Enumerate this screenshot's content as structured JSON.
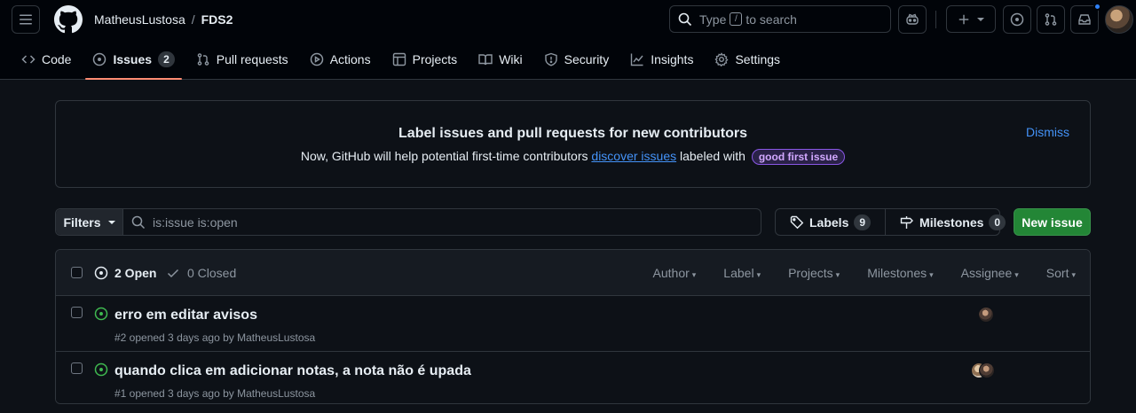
{
  "header": {
    "owner": "MatheusLustosa",
    "separator": "/",
    "repo": "FDS2",
    "search": {
      "prefix": "Type",
      "key": "/",
      "suffix": "to search"
    }
  },
  "tabs": [
    {
      "label": "Code",
      "icon": "code-icon"
    },
    {
      "label": "Issues",
      "icon": "issue-opened-icon",
      "count": "2",
      "active": true
    },
    {
      "label": "Pull requests",
      "icon": "git-pull-request-icon"
    },
    {
      "label": "Actions",
      "icon": "play-icon"
    },
    {
      "label": "Projects",
      "icon": "table-icon"
    },
    {
      "label": "Wiki",
      "icon": "book-icon"
    },
    {
      "label": "Security",
      "icon": "shield-icon"
    },
    {
      "label": "Insights",
      "icon": "graph-icon"
    },
    {
      "label": "Settings",
      "icon": "gear-icon"
    }
  ],
  "banner": {
    "title": "Label issues and pull requests for new contributors",
    "text_before": "Now, GitHub will help potential first-time contributors",
    "link": "discover issues",
    "text_after": "labeled with",
    "label": "good first issue",
    "dismiss": "Dismiss"
  },
  "filters": {
    "button": "Filters",
    "query": "is:issue is:open",
    "labels": "Labels",
    "labels_count": "9",
    "milestones": "Milestones",
    "milestones_count": "0",
    "new_issue": "New issue"
  },
  "list": {
    "open_label": "2 Open",
    "closed_label": "0 Closed",
    "menus": [
      "Author",
      "Label",
      "Projects",
      "Milestones",
      "Assignee",
      "Sort"
    ]
  },
  "issues": [
    {
      "title": "erro em editar avisos",
      "meta": "#2 opened 3 days ago by MatheusLustosa"
    },
    {
      "title": "quando clica em adicionar notas, a nota não é upada",
      "meta": "#1 opened 3 days ago by MatheusLustosa"
    }
  ],
  "colors": {
    "accent": "#fd8c73",
    "link": "#4493f8",
    "open": "#3fb950",
    "primary_button": "#238636"
  }
}
